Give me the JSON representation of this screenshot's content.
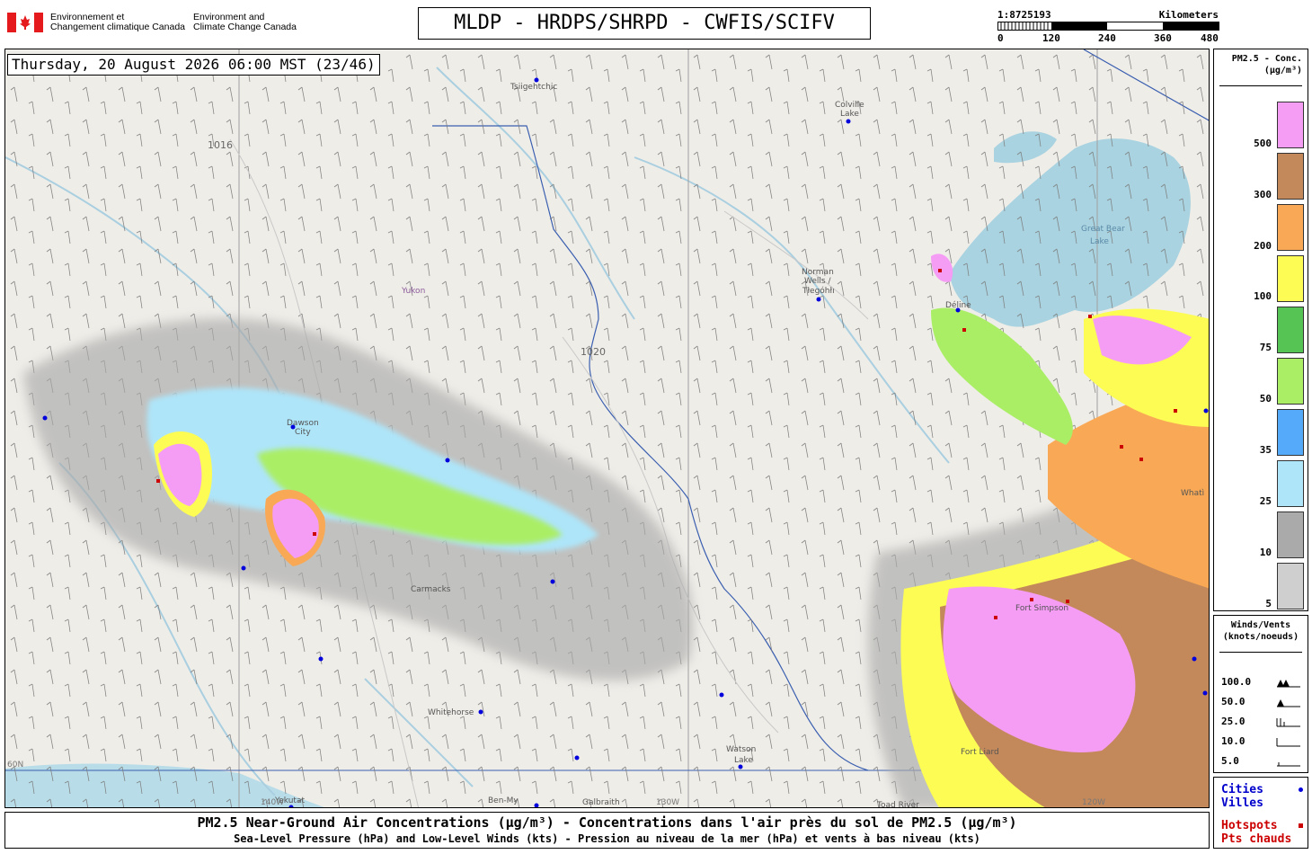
{
  "header": {
    "agency_fr_line1": "Environnement et",
    "agency_fr_line2": "Changement climatique Canada",
    "agency_en_line1": "Environment and",
    "agency_en_line2": "Climate Change Canada",
    "title": "MLDP - HRDPS/SHRPD - CWFIS/SCIFV"
  },
  "scale": {
    "ratio": "1:8725193",
    "unit": "Kilometers",
    "ticks": [
      "0",
      "120",
      "240",
      "360",
      "480"
    ]
  },
  "map": {
    "timestamp": "Thursday, 20 August 2026 06:00 MST (23/46)",
    "place_labels": [
      "Tsiigehtchic",
      "Colville",
      "Lake",
      "Great Bear",
      "Lake",
      "Norman",
      "Wells /",
      "Tłegóhłı",
      "Yukon",
      "Déline",
      "Dawson",
      "City",
      "Carmacks",
      "Whitehorse",
      "Watson",
      "Lake",
      "Fort Simpson",
      "Fort Liard",
      "Whatì",
      "Yakutat",
      "Ben-My",
      "Galbraith",
      "Toad River"
    ],
    "isobar_labels": [
      "1016",
      "1020"
    ],
    "graticule_labels": [
      "60N",
      "140W",
      "130W",
      "120W"
    ],
    "colors": {
      "land": "#efede8",
      "water": "#a9d3e0",
      "ocean": "#b8dce8",
      "border": "#3a5fb0",
      "city": "#0000dd",
      "hotspot": "#cc0000"
    }
  },
  "legend_pm25": {
    "title_line1": "PM2.5 - Conc.",
    "title_line2": "(µg/m³)",
    "classes": [
      {
        "label": "500",
        "color": "#f59cf5"
      },
      {
        "label": "300",
        "color": "#c4895a"
      },
      {
        "label": "200",
        "color": "#f9a955"
      },
      {
        "label": "100",
        "color": "#fcfc55"
      },
      {
        "label": "75",
        "color": "#55c455"
      },
      {
        "label": "50",
        "color": "#aaee66"
      },
      {
        "label": "35",
        "color": "#55aaf9"
      },
      {
        "label": "25",
        "color": "#aee5f9"
      },
      {
        "label": "10",
        "color": "#aaaaaa"
      },
      {
        "label": "5",
        "color": "#cfcfcf"
      }
    ]
  },
  "legend_winds": {
    "title_line1": "Winds/Vents",
    "title_line2": "(knots/noeuds)",
    "speeds": [
      "100.0",
      "50.0",
      "25.0",
      "10.0",
      "5.0"
    ]
  },
  "legend_keys": {
    "cities_en": "Cities",
    "cities_fr": "Villes",
    "hotspots_en": "Hotspots",
    "hotspots_fr": "Pts chauds"
  },
  "footer": {
    "line1": "PM2.5 Near-Ground Air Concentrations (µg/m³) - Concentrations dans l'air près du sol de PM2.5 (µg/m³)",
    "line2": "Sea-Level Pressure (hPa) and Low-Level Winds (kts) - Pression au niveau de la mer (hPa) et vents à bas niveau (kts)"
  }
}
